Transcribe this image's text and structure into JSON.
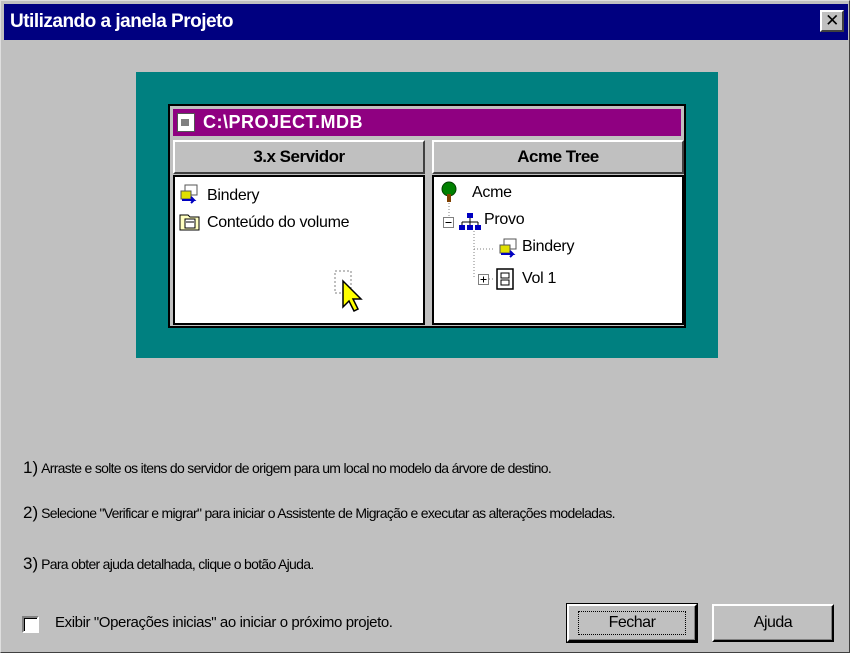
{
  "dialog": {
    "title": "Utilizando a janela Projeto",
    "close_label": "✕"
  },
  "illustration": {
    "window_title": "C:\\PROJECT.MDB",
    "left_pane": {
      "header": "3.x Servidor",
      "items": [
        "Bindery",
        "Conteúdo do volume"
      ]
    },
    "right_pane": {
      "header": "Acme Tree",
      "tree": {
        "root": "Acme",
        "org": "Provo",
        "children": [
          "Bindery",
          "Vol 1"
        ]
      }
    }
  },
  "instructions": [
    {
      "num": "1)",
      "text": "Arraste e solte os itens do servidor de origem para um local no modelo da árvore de destino."
    },
    {
      "num": "2)",
      "text": "Selecione \"Verificar e migrar\" para iniciar o Assistente de Migração e executar as alterações modeladas."
    },
    {
      "num": "3)",
      "text": "Para obter ajuda detalhada, clique o botão Ajuda."
    }
  ],
  "footer": {
    "checkbox_label": "Exibir  \"Operações inicias\" ao iniciar o próximo projeto.",
    "checkbox_checked": false,
    "close_button": "Fechar",
    "help_button": "Ajuda"
  },
  "colors": {
    "titlebar": "#000080",
    "illustration_bg": "#008080",
    "window_titlebar": "#8f0081"
  }
}
